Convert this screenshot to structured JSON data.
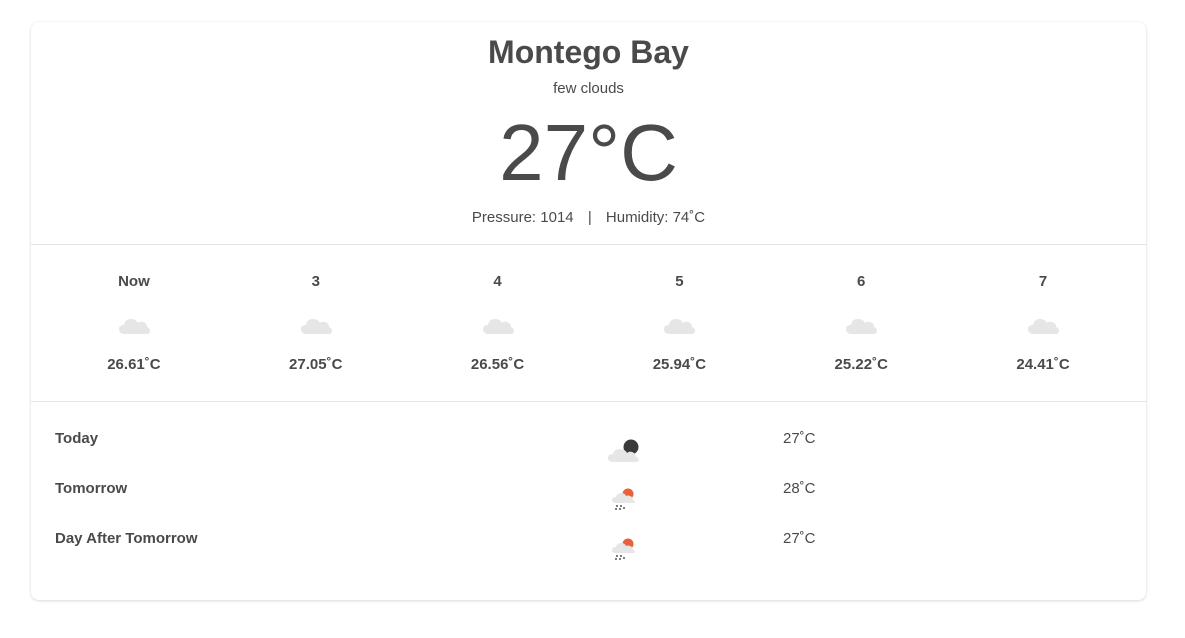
{
  "current": {
    "city": "Montego Bay",
    "description": "few clouds",
    "temperature": "27°C",
    "pressure_label": "Pressure: 1014",
    "separator": "|",
    "humidity_label": "Humidity: 74˚C",
    "icon": "cloud-icon"
  },
  "hourly": [
    {
      "label": "Now",
      "temp": "26.61˚C",
      "icon": "cloud-icon"
    },
    {
      "label": "3",
      "temp": "27.05˚C",
      "icon": "cloud-icon"
    },
    {
      "label": "4",
      "temp": "26.56˚C",
      "icon": "cloud-icon"
    },
    {
      "label": "5",
      "temp": "25.94˚C",
      "icon": "cloud-icon"
    },
    {
      "label": "6",
      "temp": "25.22˚C",
      "icon": "cloud-icon"
    },
    {
      "label": "7",
      "temp": "24.41˚C",
      "icon": "cloud-icon"
    }
  ],
  "daily": [
    {
      "name": "Today",
      "temp": "27˚C",
      "icon": "night-cloud-icon"
    },
    {
      "name": "Tomorrow",
      "temp": "28˚C",
      "icon": "sun-rain-cloud-icon"
    },
    {
      "name": "Day After Tomorrow",
      "temp": "27˚C",
      "icon": "sun-rain-cloud-icon"
    }
  ],
  "colors": {
    "text": "#4a4a4a",
    "cloud": "#e6e6e6",
    "moon": "#3a3a3a",
    "sun": "#e8603c",
    "divider": "#e4e4e4"
  }
}
